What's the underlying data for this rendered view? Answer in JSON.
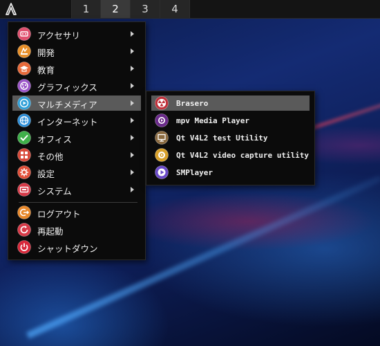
{
  "panel": {
    "logo_icon": "archlabs-logo-icon",
    "workspaces": [
      {
        "label": "1",
        "active": false
      },
      {
        "label": "2",
        "active": true
      },
      {
        "label": "3",
        "active": false
      },
      {
        "label": "4",
        "active": false
      }
    ]
  },
  "main_menu": {
    "items": [
      {
        "label": "アクセサリ",
        "icon": "accessories-icon",
        "color": "#e0506e",
        "submenu": true
      },
      {
        "label": "開発",
        "icon": "development-icon",
        "color": "#e8902a",
        "submenu": true
      },
      {
        "label": "教育",
        "icon": "education-icon",
        "color": "#e86a3a",
        "submenu": true
      },
      {
        "label": "グラフィックス",
        "icon": "graphics-icon",
        "color": "#9b55c8",
        "submenu": true
      },
      {
        "label": "マルチメディア",
        "icon": "multimedia-icon",
        "color": "#2e9fd8",
        "submenu": true,
        "active": true
      },
      {
        "label": "インターネット",
        "icon": "internet-icon",
        "color": "#2e8fd8",
        "submenu": true
      },
      {
        "label": "オフィス",
        "icon": "office-icon",
        "color": "#3fb04a",
        "submenu": true
      },
      {
        "label": "その他",
        "icon": "other-icon",
        "color": "#d84a3a",
        "submenu": true
      },
      {
        "label": "設定",
        "icon": "settings-icon",
        "color": "#e0503a",
        "submenu": true
      },
      {
        "label": "システム",
        "icon": "system-icon",
        "color": "#d83a48",
        "submenu": true
      },
      {
        "label": "ログアウト",
        "icon": "logout-icon",
        "color": "#e8882a",
        "submenu": false
      },
      {
        "label": "再起動",
        "icon": "reboot-icon",
        "color": "#d83a48",
        "submenu": false
      },
      {
        "label": "シャットダウン",
        "icon": "shutdown-icon",
        "color": "#d8283a",
        "submenu": false
      }
    ]
  },
  "sub_menu": {
    "items": [
      {
        "label": "Brasero",
        "icon": "brasero-icon",
        "color": "#c0303a",
        "active": true
      },
      {
        "label": "mpv Media Player",
        "icon": "mpv-icon",
        "color": "#6a2a8a"
      },
      {
        "label": "Qt V4L2 test Utility",
        "icon": "qv4l2-icon",
        "color": "#8a6a40"
      },
      {
        "label": "Qt V4L2 video capture utility",
        "icon": "qvidcap-icon",
        "color": "#d8a02a"
      },
      {
        "label": "SMPlayer",
        "icon": "smplayer-icon",
        "color": "#6a4ac8"
      }
    ]
  }
}
